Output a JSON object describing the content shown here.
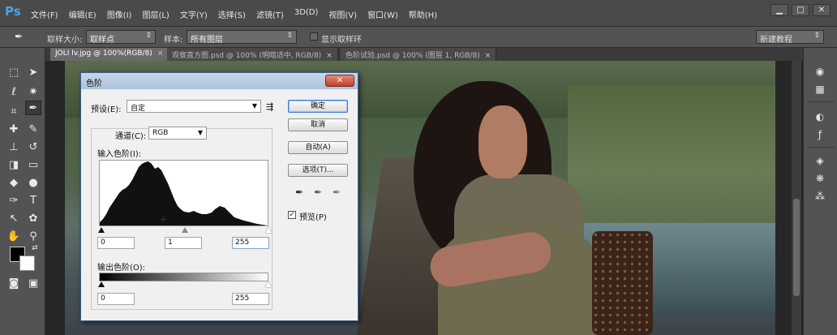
{
  "app": {
    "logo": "Ps"
  },
  "menu": [
    "文件(F)",
    "编辑(E)",
    "图像(I)",
    "图层(L)",
    "文字(Y)",
    "选择(S)",
    "滤镜(T)",
    "3D(D)",
    "视图(V)",
    "窗口(W)",
    "帮助(H)"
  ],
  "window_controls": {
    "minimize": "▁",
    "maximize": "□",
    "close": "✕"
  },
  "options_bar": {
    "sample_size_label": "取样大小:",
    "sample_size_value": "取样点",
    "sample_label": "样本:",
    "sample_value": "所有图层",
    "show_ring_label": "显示取样环",
    "workspace": "新建教程"
  },
  "tabs": [
    {
      "label": "JOLI lv.jpg @ 100%(RGB/8)",
      "close": "×"
    },
    {
      "label": "观察直方图.psd @ 100% (明暗适中, RGB/8)",
      "close": "×"
    },
    {
      "label": "色阶试验.psd @ 100% (图层 1, RGB/8)",
      "close": "×"
    }
  ],
  "tools": [
    "marquee-icon",
    "move-icon",
    "lasso-icon",
    "magic-wand-icon",
    "crop-icon",
    "eyedropper-icon",
    "healing-icon",
    "brush-icon",
    "stamp-icon",
    "history-brush-icon",
    "eraser-icon",
    "gradient-icon",
    "blur-icon",
    "dodge-icon",
    "pen-icon",
    "type-icon",
    "path-select-icon",
    "shape-icon",
    "hand-icon",
    "zoom-icon"
  ],
  "dock": [
    "color-panel-icon",
    "swatches-icon",
    "adjust-icon",
    "styles-icon",
    "layers-icon",
    "channels-icon"
  ],
  "levels": {
    "title": "色阶",
    "close": "✕",
    "preset_label": "预设(E):",
    "preset_value": "自定",
    "channel_label": "通道(C):",
    "channel_value": "RGB",
    "input_label": "输入色阶(I):",
    "output_label": "输出色阶(O):",
    "input_black": "0",
    "input_gamma": "1",
    "input_white": "255",
    "output_black": "0",
    "output_white": "255",
    "buttons": {
      "ok": "确定",
      "cancel": "取消",
      "auto": "自动(A)",
      "options": "选项(T)..."
    },
    "preview_label": "预览(P)",
    "preview_checked": "✓"
  }
}
